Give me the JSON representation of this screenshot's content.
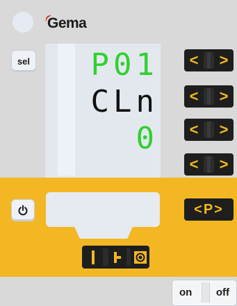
{
  "brand": {
    "logo_text": "Gema",
    "accent_color": "#d9261c"
  },
  "display": {
    "line1": "P01",
    "line2": "CLn",
    "line3": "0",
    "line1_color": "#2fd12f",
    "line2_color": "#111111",
    "line3_color": "#2fd12f"
  },
  "buttons": {
    "sel_label": "sel",
    "power_icon": "power-icon",
    "arrow_left": "<",
    "arrow_right": ">",
    "program_label": "<P>",
    "mode_icons": [
      "line-icon",
      "spray-icon",
      "target-icon"
    ]
  },
  "switch": {
    "on_label": "on",
    "off_label": "off"
  },
  "colors": {
    "panel_yellow": "#f2b723",
    "button_black": "#1e1e1e",
    "button_text_yellow": "#f2b721"
  }
}
